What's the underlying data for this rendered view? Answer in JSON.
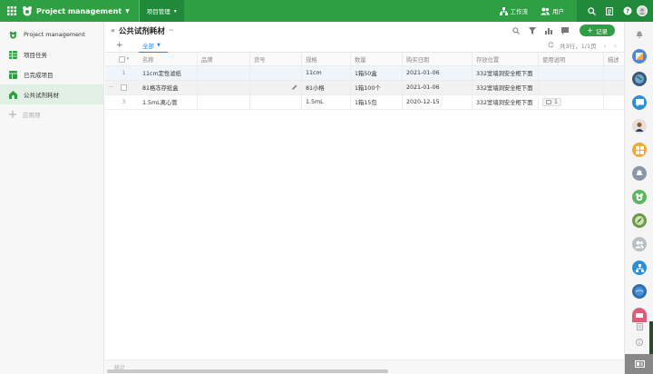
{
  "topbar": {
    "app_title": "Project management",
    "active_tab": "项目管理",
    "workflow_label": "工作流",
    "users_label": "用户"
  },
  "sidebar": {
    "items": [
      {
        "label": "Project management",
        "icon": "leaf-logo-icon",
        "active": false
      },
      {
        "label": "项目任务",
        "icon": "grid-sheet-icon",
        "active": false
      },
      {
        "label": "已完成项目",
        "icon": "sheet-icon",
        "active": false
      },
      {
        "label": "公共试剂耗材",
        "icon": "house-icon",
        "active": true
      }
    ],
    "add_label": "应用项"
  },
  "header": {
    "title": "公共试剂耗材",
    "record_button": "记录"
  },
  "views": {
    "active_view": "全部",
    "count_text": "共3行，1/1页"
  },
  "table": {
    "columns": [
      "名称",
      "品牌",
      "货号",
      "规格",
      "数量",
      "购买日期",
      "存放位置",
      "使用说明",
      "描述"
    ],
    "rows": [
      {
        "num": "1",
        "name": "11cm定性滤纸",
        "brand": "",
        "code": "",
        "spec": "11cm",
        "qty": "1箱50盒",
        "date": "2021-01-06",
        "location": "332室墙洞安全柜下面",
        "note": "",
        "note_count": ""
      },
      {
        "num": "2",
        "name": "81格冻存纸盒",
        "brand": "",
        "code": "",
        "spec": "81小格",
        "qty": "1箱100个",
        "date": "2021-01-06",
        "location": "332室墙洞安全柜下面",
        "note": "",
        "note_count": ""
      },
      {
        "num": "3",
        "name": "1.5mL离心管",
        "brand": "",
        "code": "",
        "spec": "1.5mL",
        "qty": "1箱15包",
        "date": "2020-12-15",
        "location": "332室墙洞安全柜下面",
        "note": "",
        "note_count": "1"
      }
    ]
  },
  "footer": {
    "stats_label": "统计"
  },
  "colors": {
    "brand_green": "#2ea043",
    "brand_green_dark": "#218a3a",
    "active_blue": "#1e88e5",
    "row_highlight": "#eef5fb"
  },
  "rail_icons": [
    "bell-icon",
    "app-icon",
    "globe-icon",
    "chat-icon",
    "person-avatar",
    "grid-app-icon",
    "notification-icon",
    "leaf-app-icon",
    "plant-avatar",
    "group-icon",
    "org-icon",
    "earth-icon",
    "calendar-icon",
    "doc-icon",
    "info-icon",
    "card-icon"
  ]
}
